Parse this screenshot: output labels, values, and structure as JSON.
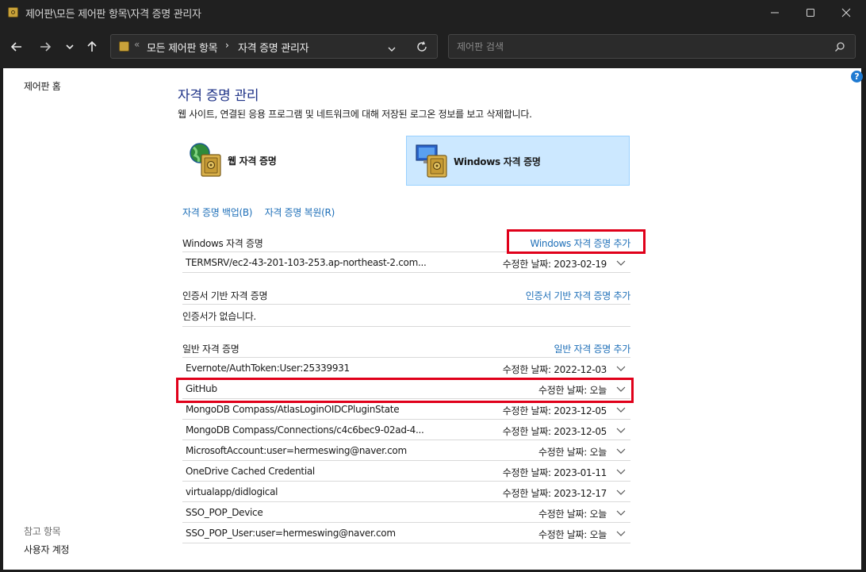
{
  "window": {
    "title": "제어판\\모든 제어판 항목\\자격 증명 관리자",
    "minimize_icon": "minimize-icon",
    "maximize_icon": "maximize-icon",
    "close_icon": "close-icon"
  },
  "nav": {
    "back_icon": "back-arrow-icon",
    "forward_icon": "forward-arrow-icon",
    "recent_icon": "chevron-down-icon",
    "up_icon": "up-arrow-icon",
    "address_prefix": "«",
    "crumb_all_items": "모든 제어판 항목",
    "crumb_separator": "›",
    "crumb_current": "자격 증명 관리자",
    "search_placeholder": "제어판 검색"
  },
  "left_nav": {
    "home": "제어판 홈",
    "see_also": "참고 항목",
    "user_accounts": "사용자 계정"
  },
  "help": {
    "label": "?"
  },
  "main": {
    "title": "자격 증명 관리",
    "description": "웹 사이트, 연결된 응용 프로그램 및 네트워크에 대해 저장된 로그온 정보를 보고 삭제합니다.",
    "web_tile_label": "웹 자격 증명",
    "windows_tile_label": "Windows 자격 증명",
    "backup_link": "자격 증명 백업(B)",
    "restore_link": "자격 증명 복원(R)"
  },
  "sections": {
    "windows": {
      "title": "Windows 자격 증명",
      "add": "Windows 자격 증명 추가",
      "items": [
        {
          "name": "TERMSRV/ec2-43-201-103-253.ap-northeast-2.com...",
          "date": "수정한 날짜:  2023-02-19"
        }
      ]
    },
    "certificate": {
      "title": "인증서 기반 자격 증명",
      "add": "인증서 기반 자격 증명 추가",
      "empty": "인증서가 없습니다."
    },
    "generic": {
      "title": "일반 자격 증명",
      "add": "일반 자격 증명 추가",
      "items": [
        {
          "name": "Evernote/AuthToken:User:25339931",
          "date": "수정한 날짜:  2022-12-03"
        },
        {
          "name": "GitHub",
          "date": "수정한 날짜:  오늘"
        },
        {
          "name": "MongoDB Compass/AtlasLoginOIDCPluginState",
          "date": "수정한 날짜:  2023-12-05"
        },
        {
          "name": "MongoDB Compass/Connections/c4c6bec9-02ad-4...",
          "date": "수정한 날짜:  2023-12-05"
        },
        {
          "name": "MicrosoftAccount:user=hermeswing@naver.com",
          "date": "수정한 날짜:  오늘"
        },
        {
          "name": "OneDrive Cached Credential",
          "date": "수정한 날짜:  2023-01-11"
        },
        {
          "name": "virtualapp/didlogical",
          "date": "수정한 날짜:  2023-12-17"
        },
        {
          "name": "SSO_POP_Device",
          "date": "수정한 날짜:  오늘"
        },
        {
          "name": "SSO_POP_User:user=hermeswing@naver.com",
          "date": "수정한 날짜:  오늘"
        }
      ]
    }
  },
  "colors": {
    "link": "#1e6fb8",
    "title": "#1e3287",
    "highlight": "#e0001a",
    "selected_tile": "#cce8ff"
  }
}
